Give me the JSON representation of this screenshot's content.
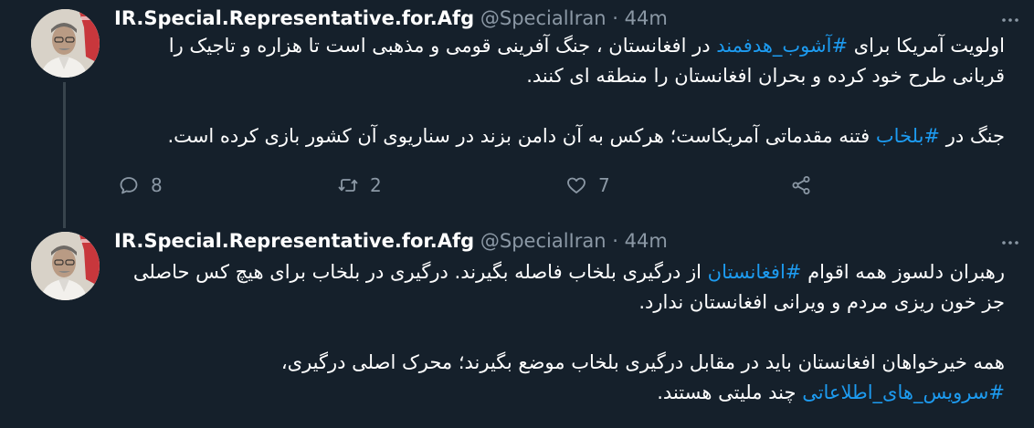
{
  "tweets": [
    {
      "display_name": "IR.Special.Representative.for.Afg",
      "handle": "@SpecialIran",
      "separator": "·",
      "time": "44m",
      "body": [
        [
          {
            "text": "اولویت آمریکا برای ",
            "hashtag": false
          },
          {
            "text": "#آشوب_هدفمند",
            "hashtag": true
          },
          {
            "text": " در افغانستان ، جنگ آفرینی قومی و مذهبی است تا هزاره و تاجیک را قربانی طرح خود کرده و بحران افغانستان را منطقه ای کنند.",
            "hashtag": false
          }
        ],
        [
          {
            "text": "جنگ در ",
            "hashtag": false
          },
          {
            "text": "#بلخاب",
            "hashtag": true
          },
          {
            "text": " فتنه مقدماتی آمریکاست؛ هرکس به آن دامن بزند در سناریوی آن کشور بازی کرده است.",
            "hashtag": false
          }
        ]
      ],
      "replies": "8",
      "retweets": "2",
      "likes": "7"
    },
    {
      "display_name": "IR.Special.Representative.for.Afg",
      "handle": "@SpecialIran",
      "separator": "·",
      "time": "44m",
      "body": [
        [
          {
            "text": "رهبران دلسوز همه اقوام ",
            "hashtag": false
          },
          {
            "text": "#افغانستان",
            "hashtag": true
          },
          {
            "text": " از درگیری بلخاب فاصله بگیرند. درگیری در بلخاب برای هیچ کس حاصلی جز خون ریزی مردم و ویرانی افغانستان ندارد.",
            "hashtag": false
          }
        ],
        [
          {
            "text": "همه خیرخواهان افغانستان باید در مقابل درگیری بلخاب موضع بگیرند؛ محرک اصلی درگیری، ",
            "hashtag": false
          },
          {
            "text": "#سرویس_های_اطلاعاتی",
            "hashtag": true
          },
          {
            "text": " چند ملیتی هستند.",
            "hashtag": false
          }
        ]
      ]
    }
  ],
  "theme": {
    "background": "#15202b",
    "text": "#ffffff",
    "muted": "#8b98a5",
    "link": "#1d9bf0",
    "thread_line": "#38444d"
  },
  "icons": {
    "reply": "reply-icon",
    "retweet": "retweet-icon",
    "like": "heart-icon",
    "share": "share-icon",
    "more": "more-icon"
  }
}
